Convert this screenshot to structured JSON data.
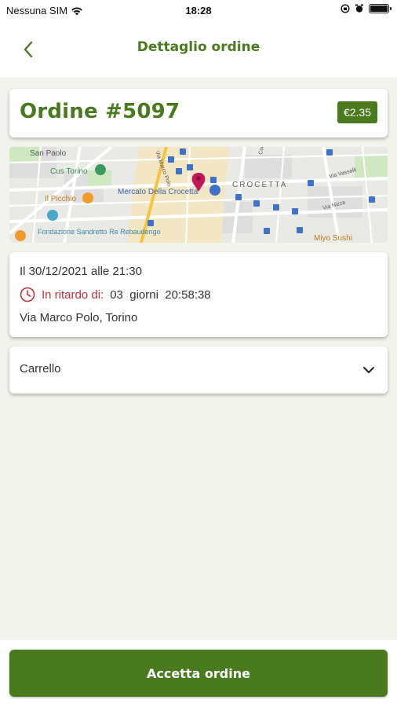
{
  "status_bar": {
    "carrier": "Nessuna SIM",
    "time": "18:28",
    "battery_level": 1.0
  },
  "header": {
    "title": "Dettaglio ordine",
    "back_icon": "chevron-left-icon"
  },
  "order": {
    "title": "Ordine #5097",
    "price": "€2.35"
  },
  "map": {
    "labels": [
      "San Paolo",
      "Cus Torino",
      "Il Picchio",
      "Mercato Della Crocetta",
      "CROCETTA",
      "Fondazione Sandretto Re Rebaudengo",
      "Miyo Sushi",
      "Via Marco Polo",
      "Corso",
      "Via Vassalli",
      "Via Nizza"
    ],
    "pin_color": "#c2185b"
  },
  "details": {
    "date": "Il 30/12/2021 alle 21:30",
    "delay_label": "In ritardo di:",
    "delay_value": "03  giorni  20:58:38",
    "address": "Via Marco Polo, Torino"
  },
  "cart": {
    "label": "Carrello"
  },
  "actions": {
    "accept_label": "Accetta ordine"
  },
  "colors": {
    "primary": "#4a7a1e",
    "delay": "#c0303a",
    "background": "#f1f3ec"
  }
}
